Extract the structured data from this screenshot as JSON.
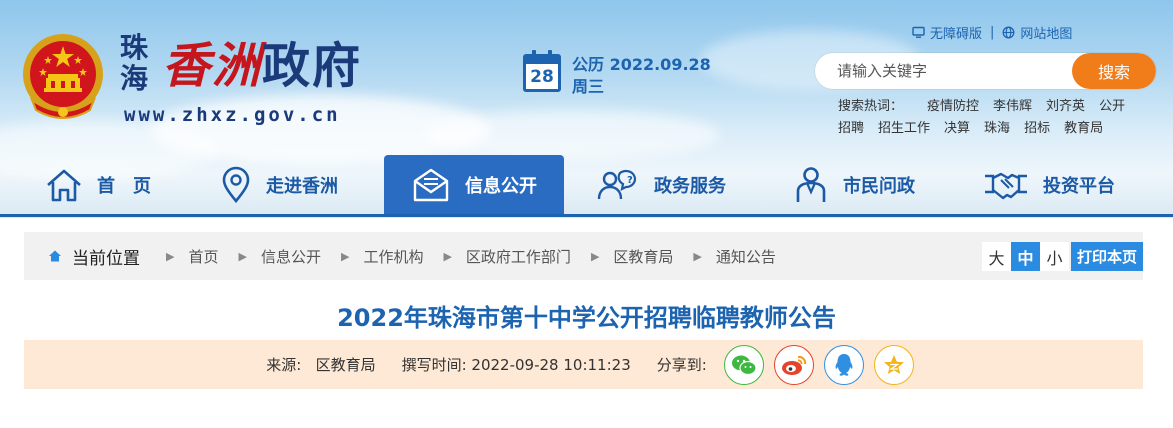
{
  "header": {
    "logo": {
      "city": "珠海",
      "name_red": "香洲",
      "name_blue": "政府",
      "url": "www.zhxz.gov.cn"
    },
    "date": {
      "day": "28",
      "line1": "公历 2022.09.28",
      "line2": "周三"
    },
    "top_links": {
      "accessible": "无障碍版",
      "separator": "|",
      "sitemap": "网站地图"
    },
    "search": {
      "placeholder": "请输入关键字",
      "button": "搜索"
    },
    "hot": {
      "label": "搜索热词：",
      "keywords": [
        "疫情防控",
        "李伟辉",
        "刘齐英",
        "公开招聘",
        "招生工作",
        "决算",
        "珠海",
        "招标",
        "教育局"
      ]
    }
  },
  "nav": {
    "items": [
      {
        "label": "首　页",
        "icon": "home-icon"
      },
      {
        "label": "走进香洲",
        "icon": "location-pin-icon"
      },
      {
        "label": "信息公开",
        "icon": "mail-icon"
      },
      {
        "label": "政务服务",
        "icon": "service-people-icon"
      },
      {
        "label": "市民问政",
        "icon": "citizen-icon"
      },
      {
        "label": "投资平台",
        "icon": "handshake-icon"
      }
    ],
    "active_index": 2,
    "colors": {
      "active_bg": "#2a6cc2",
      "text": "#1c5aa6",
      "line": "#1c63b0"
    }
  },
  "breadcrumb": {
    "current_label": "当前位置",
    "items": [
      "首页",
      "信息公开",
      "工作机构",
      "区政府工作部门",
      "区教育局",
      "通知公告"
    ],
    "size_controls": [
      "大",
      "中",
      "小"
    ],
    "size_selected": "中",
    "print": "打印本页"
  },
  "article": {
    "title": "2022年珠海市第十中学公开招聘临聘教师公告",
    "source_label": "来源:",
    "source": "区教育局",
    "time_label": "撰写时间:",
    "time": "2022-09-28 10:11:23",
    "share_label": "分享到:",
    "share_targets": [
      {
        "icon": "wechat-icon",
        "color": "#3db93f"
      },
      {
        "icon": "weibo-icon",
        "color": "#e6432b"
      },
      {
        "icon": "qq-icon",
        "color": "#2f8fe0"
      },
      {
        "icon": "qzone-icon",
        "color": "#f2b416"
      }
    ]
  }
}
